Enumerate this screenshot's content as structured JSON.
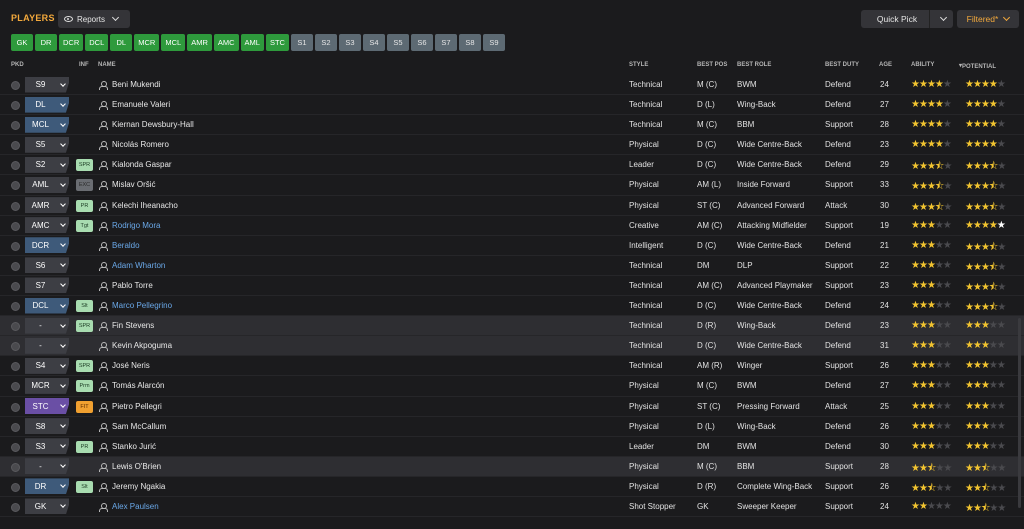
{
  "header": {
    "title": "PLAYERS",
    "reports_label": "Reports",
    "quick_pick_label": "Quick Pick",
    "filter_label": "Filtered*"
  },
  "position_chips": [
    {
      "label": "GK",
      "active": true
    },
    {
      "label": "DR",
      "active": true
    },
    {
      "label": "DCR",
      "active": true
    },
    {
      "label": "DCL",
      "active": true
    },
    {
      "label": "DL",
      "active": true
    },
    {
      "label": "MCR",
      "active": true
    },
    {
      "label": "MCL",
      "active": true
    },
    {
      "label": "AMR",
      "active": true
    },
    {
      "label": "AMC",
      "active": true
    },
    {
      "label": "AML",
      "active": true
    },
    {
      "label": "STC",
      "active": true
    },
    {
      "label": "S1",
      "active": false
    },
    {
      "label": "S2",
      "active": false
    },
    {
      "label": "S3",
      "active": false
    },
    {
      "label": "S4",
      "active": false
    },
    {
      "label": "S5",
      "active": false
    },
    {
      "label": "S6",
      "active": false
    },
    {
      "label": "S7",
      "active": false
    },
    {
      "label": "S8",
      "active": false
    },
    {
      "label": "S9",
      "active": false
    }
  ],
  "columns": {
    "pkd": "PKD",
    "inf": "INF",
    "name": "NAME",
    "style": "STYLE",
    "best_pos": "BEST POS",
    "best_role": "BEST ROLE",
    "best_duty": "BEST DUTY",
    "age": "AGE",
    "ability": "ABILITY",
    "potential": "POTENTIAL"
  },
  "colors": {
    "accent": "#f3a93c",
    "chip_active": "#2e9a3c",
    "chip_inactive": "#5d6a73",
    "star": "#f2c430",
    "link": "#6aa8e8"
  },
  "players": [
    {
      "pkd": "S9",
      "pkd_style": "d",
      "inf": "",
      "name": "Beni Mukendi",
      "link": false,
      "style": "Technical",
      "best_pos": "M (C)",
      "role": "BWM",
      "duty": "Defend",
      "age": "24",
      "ability": 4,
      "potential": 4,
      "highlight": false
    },
    {
      "pkd": "DL",
      "pkd_style": "b",
      "inf": "",
      "name": "Emanuele Valeri",
      "link": false,
      "style": "Technical",
      "best_pos": "D (L)",
      "role": "Wing-Back",
      "duty": "Defend",
      "age": "27",
      "ability": 4,
      "potential": 4,
      "highlight": false
    },
    {
      "pkd": "MCL",
      "pkd_style": "b",
      "inf": "",
      "name": "Kiernan Dewsbury-Hall",
      "link": false,
      "style": "Technical",
      "best_pos": "M (C)",
      "role": "BBM",
      "duty": "Support",
      "age": "28",
      "ability": 4,
      "potential": 4,
      "highlight": false
    },
    {
      "pkd": "S5",
      "pkd_style": "d",
      "inf": "",
      "name": "Nicolás Romero",
      "link": false,
      "style": "Physical",
      "best_pos": "D (C)",
      "role": "Wide Centre-Back",
      "duty": "Defend",
      "age": "23",
      "ability": 4,
      "potential": 4,
      "highlight": false
    },
    {
      "pkd": "S2",
      "pkd_style": "d",
      "inf": "SPR",
      "inf_style": "gn",
      "name": "Kialonda Gaspar",
      "link": false,
      "style": "Leader",
      "best_pos": "D (C)",
      "role": "Wide Centre-Back",
      "duty": "Defend",
      "age": "29",
      "ability": 3.5,
      "potential": 3.5,
      "highlight": false
    },
    {
      "pkd": "AML",
      "pkd_style": "d",
      "inf": "EXC",
      "inf_style": "gr",
      "name": "Mislav Oršić",
      "link": false,
      "style": "Physical",
      "best_pos": "AM (L)",
      "role": "Inside Forward",
      "duty": "Support",
      "age": "33",
      "ability": 3.5,
      "potential": 3.5,
      "highlight": false
    },
    {
      "pkd": "AMR",
      "pkd_style": "d",
      "inf": "PR",
      "inf_style": "gn",
      "name": "Kelechi Iheanacho",
      "link": false,
      "style": "Physical",
      "best_pos": "ST (C)",
      "role": "Advanced Forward",
      "duty": "Attack",
      "age": "30",
      "ability": 3.5,
      "potential": 3.5,
      "highlight": false
    },
    {
      "pkd": "AMC",
      "pkd_style": "d",
      "inf": "Tgt",
      "inf_style": "gn",
      "name": "Rodrigo Mora",
      "link": true,
      "style": "Creative",
      "best_pos": "AM (C)",
      "role": "Attacking Midfielder",
      "duty": "Support",
      "age": "19",
      "ability": 3,
      "potential": 4.5,
      "highlight": false
    },
    {
      "pkd": "DCR",
      "pkd_style": "b",
      "inf": "",
      "name": "Beraldo",
      "link": true,
      "style": "Intelligent",
      "best_pos": "D (C)",
      "role": "Wide Centre-Back",
      "duty": "Defend",
      "age": "21",
      "ability": 3,
      "potential": 3.5,
      "highlight": false
    },
    {
      "pkd": "S6",
      "pkd_style": "d",
      "inf": "",
      "name": "Adam Wharton",
      "link": true,
      "style": "Technical",
      "best_pos": "DM",
      "role": "DLP",
      "duty": "Support",
      "age": "22",
      "ability": 3,
      "potential": 3.5,
      "highlight": false
    },
    {
      "pkd": "S7",
      "pkd_style": "d",
      "inf": "",
      "name": "Pablo Torre",
      "link": false,
      "style": "Technical",
      "best_pos": "AM (C)",
      "role": "Advanced Playmaker",
      "duty": "Support",
      "age": "23",
      "ability": 3,
      "potential": 3.5,
      "highlight": false
    },
    {
      "pkd": "DCL",
      "pkd_style": "b",
      "inf": "Slt",
      "inf_style": "gn",
      "name": "Marco Pellegrino",
      "link": true,
      "style": "Technical",
      "best_pos": "D (C)",
      "role": "Wide Centre-Back",
      "duty": "Defend",
      "age": "24",
      "ability": 3,
      "potential": 3.5,
      "highlight": false
    },
    {
      "pkd": "-",
      "pkd_style": "n",
      "inf": "SPR",
      "inf_style": "gn",
      "name": "Fin Stevens",
      "link": false,
      "style": "Technical",
      "best_pos": "D (R)",
      "role": "Wing-Back",
      "duty": "Defend",
      "age": "23",
      "ability": 3,
      "potential": 3,
      "highlight": true
    },
    {
      "pkd": "-",
      "pkd_style": "n",
      "inf": "",
      "name": "Kevin Akpoguma",
      "link": false,
      "style": "Technical",
      "best_pos": "D (C)",
      "role": "Wide Centre-Back",
      "duty": "Defend",
      "age": "31",
      "ability": 3,
      "potential": 3,
      "highlight": true
    },
    {
      "pkd": "S4",
      "pkd_style": "d",
      "inf": "SPR",
      "inf_style": "gn",
      "name": "José Neris",
      "link": false,
      "style": "Technical",
      "best_pos": "AM (R)",
      "role": "Winger",
      "duty": "Support",
      "age": "26",
      "ability": 3,
      "potential": 3,
      "highlight": false
    },
    {
      "pkd": "MCR",
      "pkd_style": "d",
      "inf": "Prm",
      "inf_style": "gn",
      "name": "Tomás Alarcón",
      "link": false,
      "style": "Physical",
      "best_pos": "M (C)",
      "role": "BWM",
      "duty": "Defend",
      "age": "27",
      "ability": 3,
      "potential": 3,
      "highlight": false
    },
    {
      "pkd": "STC",
      "pkd_style": "p",
      "inf": "FIT",
      "inf_style": "or",
      "name": "Pietro Pellegri",
      "link": false,
      "style": "Physical",
      "best_pos": "ST (C)",
      "role": "Pressing Forward",
      "duty": "Attack",
      "age": "25",
      "ability": 3,
      "potential": 3,
      "highlight": false
    },
    {
      "pkd": "S8",
      "pkd_style": "d",
      "inf": "",
      "name": "Sam McCallum",
      "link": false,
      "style": "Physical",
      "best_pos": "D (L)",
      "role": "Wing-Back",
      "duty": "Defend",
      "age": "26",
      "ability": 3,
      "potential": 3,
      "highlight": false
    },
    {
      "pkd": "S3",
      "pkd_style": "d",
      "inf": "PR",
      "inf_style": "gn",
      "name": "Stanko Jurić",
      "link": false,
      "style": "Leader",
      "best_pos": "DM",
      "role": "BWM",
      "duty": "Defend",
      "age": "30",
      "ability": 3,
      "potential": 3,
      "highlight": false
    },
    {
      "pkd": "-",
      "pkd_style": "n",
      "inf": "",
      "name": "Lewis O'Brien",
      "link": false,
      "style": "Physical",
      "best_pos": "M (C)",
      "role": "BBM",
      "duty": "Support",
      "age": "28",
      "ability": 2.5,
      "potential": 2.5,
      "highlight": true
    },
    {
      "pkd": "DR",
      "pkd_style": "b",
      "inf": "Slt",
      "inf_style": "gn",
      "name": "Jeremy Ngakia",
      "link": false,
      "style": "Physical",
      "best_pos": "D (R)",
      "role": "Complete Wing-Back",
      "duty": "Support",
      "age": "26",
      "ability": 2.5,
      "potential": 2.5,
      "highlight": false
    },
    {
      "pkd": "GK",
      "pkd_style": "d",
      "inf": "",
      "name": "Alex Paulsen",
      "link": true,
      "style": "Shot Stopper",
      "best_pos": "GK",
      "role": "Sweeper Keeper",
      "duty": "Support",
      "age": "24",
      "ability": 2,
      "potential": 2.5,
      "highlight": false
    }
  ]
}
